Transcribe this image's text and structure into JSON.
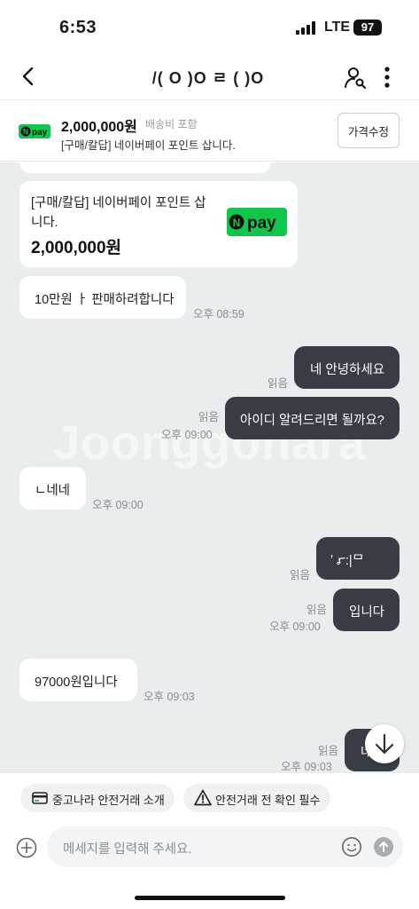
{
  "status": {
    "time": "6:53",
    "network": "LTE",
    "battery": "97"
  },
  "header": {
    "title": "/( O )O ㄹ ( )O"
  },
  "product": {
    "price": "2,000,000원",
    "shipping": "배송비 포함",
    "name": "[구매/칼답] 네이버페이 포인트 삽니다.",
    "edit_label": "가격수정",
    "pay_brand": "pay"
  },
  "chat": {
    "watermark": "Joonggonara",
    "card": {
      "title": "[구매/칼답] 네이버페이 포인트 삽니다.",
      "price": "2,000,000원",
      "brand": "pay"
    },
    "messages": [
      {
        "text": "10만원 ㅏ 판매하려합니다",
        "time": "오후 08:59"
      },
      {
        "text": "네 안녕하세요",
        "read": "읽음"
      },
      {
        "text": "아이디 알려드리면 될까요?",
        "read": "읽음",
        "time": "오후 09:00"
      },
      {
        "text": "ㄴ네네",
        "time": "오후 09:00"
      },
      {
        "text": "ʼ ꭊ:|ᄆ",
        "read": "읽음"
      },
      {
        "text": "입니다",
        "read": "읽음",
        "time": "오후 09:00"
      },
      {
        "text": "97000원입니다",
        "time": "오후 09:03"
      },
      {
        "text": "네",
        "read": "읽음",
        "time": "오후 09:03"
      }
    ]
  },
  "chips": [
    {
      "label": "중고나라 안전거래 소개",
      "icon": "card-icon"
    },
    {
      "label": "안전거래 전 확인 필수",
      "icon": "warning-icon"
    }
  ],
  "input": {
    "placeholder": "메세지를 입력해 주세요."
  },
  "colors": {
    "npay_green": "#10c74b",
    "my_bubble": "#373c45",
    "chat_bg": "#e9edee"
  }
}
